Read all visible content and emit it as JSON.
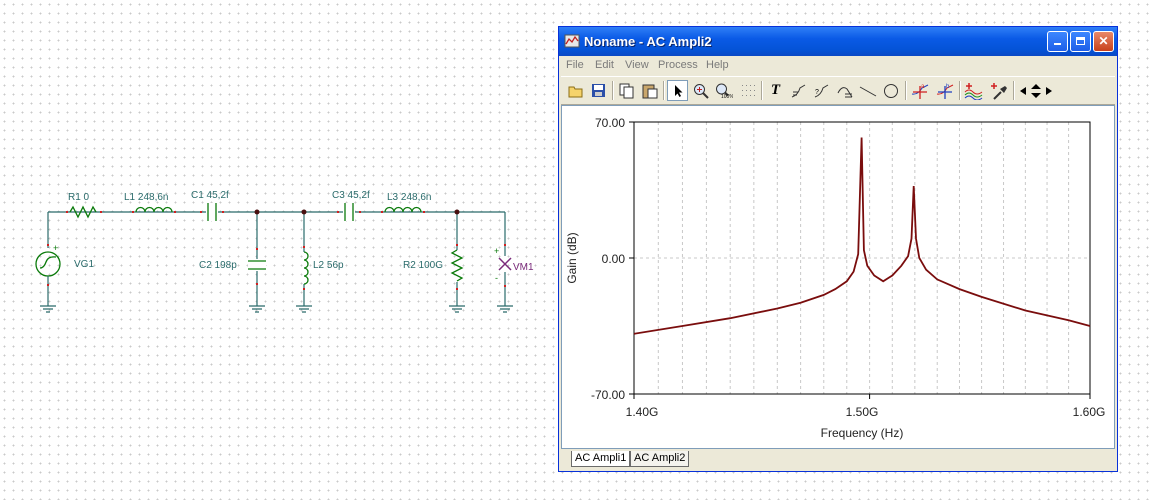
{
  "schematic": {
    "components": {
      "r1": "R1 0",
      "l1": "L1 248,6n",
      "c1": "C1 45,2f",
      "c2": "C2 198p",
      "l2": "L2 56p",
      "c3": "C3 45,2f",
      "l3": "L3 248,6n",
      "r2": "R2 100G",
      "vg1": "VG1",
      "vm1": "VM1"
    },
    "colors": {
      "wire": "#2a6b6b",
      "component": "#0a7a0a",
      "pin": "#d02020",
      "meter": "#7a2a7a"
    }
  },
  "window": {
    "title": "Noname - AC Ampli2",
    "icon": "analysis-app-icon",
    "title_buttons": [
      "minimize-icon",
      "maximize-icon",
      "close-icon"
    ],
    "menu": [
      "File",
      "Edit",
      "View",
      "Process",
      "Help"
    ],
    "toolbar_icons": [
      "open-folder-icon",
      "save-icon",
      "copy-icon",
      "paste-icon",
      "pointer-icon",
      "zoom-in-icon",
      "zoom-100-icon",
      "grid-icon",
      "text-icon",
      "curve-label-icon",
      "curve-label2-icon",
      "curve-label3-icon",
      "line-icon",
      "ellipse-icon",
      "cursor-a-icon",
      "cursor-b-icon",
      "add-curve-icon",
      "add-marker-icon",
      "arrow-left-icon",
      "arrow-updown-icon",
      "arrow-right-icon"
    ],
    "tabs": [
      "AC Ampli1",
      "AC Ampli2"
    ],
    "active_tab": "AC Ampli2",
    "colors": {
      "titlebar": "#0a5ae6",
      "curve": "#7a0d0d",
      "frame": "#ece9d8"
    }
  },
  "chart_data": {
    "type": "line",
    "title": "",
    "xlabel": "Frequency (Hz)",
    "ylabel": "Gain (dB)",
    "x_ticks": [
      "1.40G",
      "1.50G",
      "1.60G"
    ],
    "y_ticks": [
      "70.00",
      "0.00",
      "-70.00"
    ],
    "xlim": [
      1400000000.0,
      1600000000.0
    ],
    "ylim": [
      -70,
      70
    ],
    "x_scale": "log",
    "grid": true,
    "series": [
      {
        "color": "#7a0d0d",
        "x": [
          1400000000.0,
          1420000000.0,
          1440000000.0,
          1460000000.0,
          1470000000.0,
          1480000000.0,
          1485000000.0,
          1490000000.0,
          1493000000.0,
          1495000000.0,
          1496500000.0,
          1497500000.0,
          1499000000.0,
          1502000000.0,
          1506000000.0,
          1510000000.0,
          1514000000.0,
          1517000000.0,
          1518500000.0,
          1519500000.0,
          1520500000.0,
          1522000000.0,
          1525000000.0,
          1530000000.0,
          1540000000.0,
          1550000000.0,
          1570000000.0,
          1590000000.0,
          1600000000.0
        ],
        "y": [
          -39,
          -35,
          -31,
          -26,
          -23,
          -19,
          -16,
          -12,
          -7,
          2,
          62,
          4,
          -4,
          -9,
          -12,
          -9,
          -4,
          1,
          10,
          37,
          10,
          0,
          -6,
          -11,
          -16,
          -20,
          -27,
          -32,
          -35
        ]
      }
    ]
  }
}
